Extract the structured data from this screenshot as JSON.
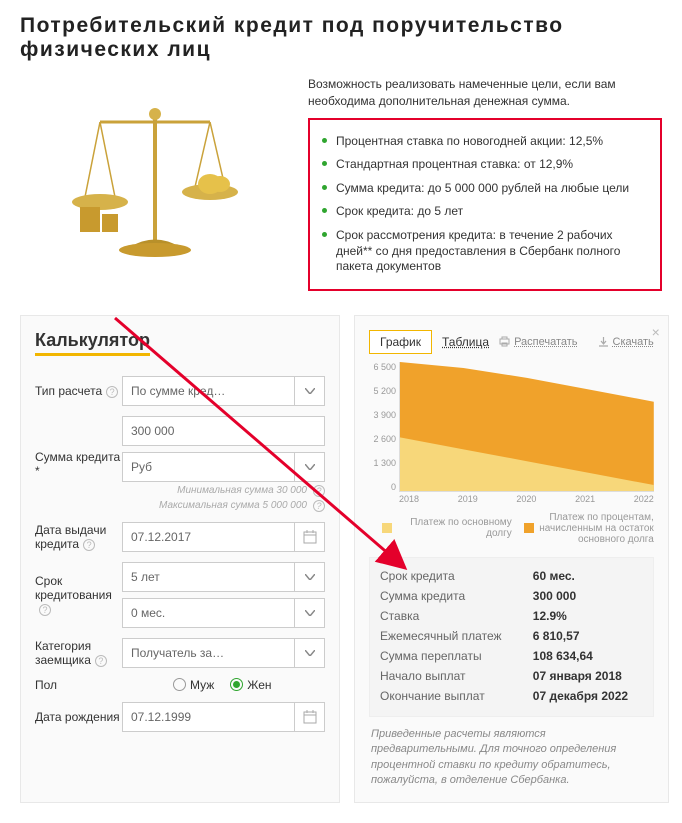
{
  "page_title": "Потребительский кредит под поручительство физических лиц",
  "intro": "Возможность реализовать намеченные цели, если вам необходима дополнительная денежная сумма.",
  "features": [
    {
      "text": "Процентная ставка по новогодней акции: 12,5%",
      "link": true
    },
    {
      "text": "Стандартная процентная ставка: от 12,9%",
      "link": true
    },
    {
      "text": "Сумма кредита: до 5 000 000 рублей на любые цели",
      "link": false
    },
    {
      "text": "Срок кредита: до 5 лет",
      "link": false
    },
    {
      "text": "Срок рассмотрения кредита: в течение 2 рабочих дней** со дня предоставления в Сбербанк полного пакета документов",
      "link": false
    }
  ],
  "calc_title": "Калькулятор",
  "form": {
    "calc_type_label": "Тип расчета",
    "calc_type_value": "По сумме кред…",
    "amount_label": "Сумма кредита *",
    "amount_value": "300 000",
    "currency_value": "Руб",
    "min_hint": "Минимальная сумма 30 000",
    "max_hint": "Максимальная сумма 5 000 000",
    "issue_date_label": "Дата выдачи кредита",
    "issue_date_value": "07.12.2017",
    "term_label": "Срок кредитования",
    "term_years_value": "5 лет",
    "term_months_value": "0 мес.",
    "category_label": "Категория заемщика",
    "category_value": "Получатель за…",
    "gender_label": "Пол",
    "gender_male": "Муж",
    "gender_female": "Жен",
    "birth_label": "Дата рождения",
    "birth_value": "07.12.1999"
  },
  "right_panel": {
    "tab_chart": "График",
    "tab_table": "Таблица",
    "print": "Распечатать",
    "download": "Скачать",
    "legend_principal": "Платеж по основному долгу",
    "legend_interest": "Платеж по процентам, начисленным на остаток основного долга",
    "color_principal": "#f7d77a",
    "color_interest": "#f0a22b"
  },
  "chart_data": {
    "type": "area",
    "xlabel": "",
    "ylabel": "",
    "ylim": [
      0,
      6500
    ],
    "y_ticks": [
      "6 500",
      "5 200",
      "3 900",
      "2 600",
      "1 300",
      "0"
    ],
    "categories": [
      "2018",
      "2019",
      "2020",
      "2021",
      "2022"
    ],
    "series": [
      {
        "name": "Платеж по процентам, начисленным на остаток основного долга",
        "color": "#f0a22b",
        "values": [
          6500,
          6200,
          5700,
          5100,
          4500
        ]
      },
      {
        "name": "Платеж по основному долгу",
        "color": "#f7d77a",
        "values": [
          2700,
          2100,
          1500,
          900,
          300
        ]
      }
    ]
  },
  "summary": {
    "rows": [
      {
        "label": "Срок кредита",
        "value": "60 мес."
      },
      {
        "label": "Сумма кредита",
        "value": "300 000"
      },
      {
        "label": "Ставка",
        "value": "12.9%"
      },
      {
        "label": "Ежемесячный платеж",
        "value": "6 810,57"
      },
      {
        "label": "Сумма переплаты",
        "value": "108 634,64"
      },
      {
        "label": "Начало выплат",
        "value": "07 января 2018"
      },
      {
        "label": "Окончание выплат",
        "value": "07 декабря 2022"
      }
    ]
  },
  "disclaimer": "Приведенные расчеты являются предварительными. Для точного определения процентной ставки по кредиту обратитесь, пожалуйста, в отделение Сбербанка."
}
